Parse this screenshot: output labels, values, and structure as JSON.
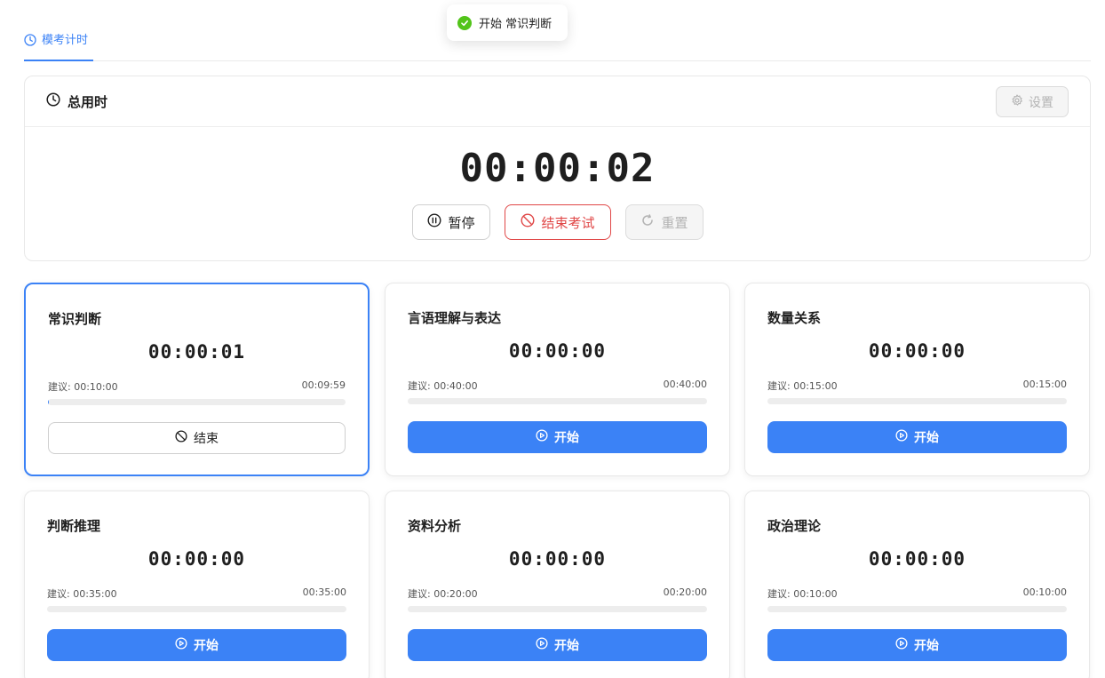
{
  "toast": {
    "text": "开始 常识判断",
    "color": "#52c41a"
  },
  "tabs": [
    {
      "label": "模考计时",
      "icon": "clock-icon",
      "active": true
    }
  ],
  "total": {
    "title": "总用时",
    "time": "00:00:02",
    "settings_label": "设置",
    "pause_label": "暂停",
    "end_label": "结束考试",
    "reset_label": "重置"
  },
  "accent_color": "#3b82f6",
  "danger_color": "#e04646",
  "subjects": [
    {
      "name": "常识判断",
      "time": "00:00:01",
      "suggest": "建议: 00:10:00",
      "remain": "00:09:59",
      "progress": 0.0017,
      "button": "结束",
      "active": true
    },
    {
      "name": "言语理解与表达",
      "time": "00:00:00",
      "suggest": "建议: 00:40:00",
      "remain": "00:40:00",
      "progress": 0,
      "button": "开始",
      "active": false
    },
    {
      "name": "数量关系",
      "time": "00:00:00",
      "suggest": "建议: 00:15:00",
      "remain": "00:15:00",
      "progress": 0,
      "button": "开始",
      "active": false
    },
    {
      "name": "判断推理",
      "time": "00:00:00",
      "suggest": "建议: 00:35:00",
      "remain": "00:35:00",
      "progress": 0,
      "button": "开始",
      "active": false
    },
    {
      "name": "资料分析",
      "time": "00:00:00",
      "suggest": "建议: 00:20:00",
      "remain": "00:20:00",
      "progress": 0,
      "button": "开始",
      "active": false
    },
    {
      "name": "政治理论",
      "time": "00:00:00",
      "suggest": "建议: 00:10:00",
      "remain": "00:10:00",
      "progress": 0,
      "button": "开始",
      "active": false
    }
  ]
}
